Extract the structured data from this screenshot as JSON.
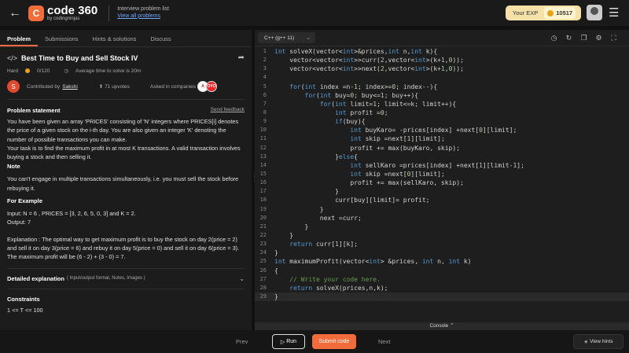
{
  "topbar": {
    "back_icon": "arrow-left-icon",
    "logo_mark": "C",
    "logo_name": "code 360",
    "logo_sub": "by codingninjas",
    "crumb_title": "Interview problem list",
    "crumb_link": "View all problems",
    "exp_label": "Your EXP",
    "exp_value": "10517",
    "menu_icon": "menu-icon"
  },
  "left": {
    "tabs": [
      "Problem",
      "Submissions",
      "Hints & solutions",
      "Discuss"
    ],
    "title": "Best Time to Buy and Sell Stock IV",
    "difficulty": "Hard",
    "score": "0/120",
    "avg_time": "Average time to solve is 20m",
    "contributed_by": "Contributed by",
    "contributor": "Sakshi",
    "contributor_initial": "S",
    "upvotes": "71 upvotes",
    "asked_in": "Asked in companies",
    "companies": [
      "A",
      "OYO"
    ],
    "statement_heading": "Problem statement",
    "send_feedback": "Send feedback",
    "statement_1": "You have been given an array 'PRICES' consisting of 'N' integers where PRICES[i] denotes the price of a given stock on the i-th day. You are also given an integer 'K' denoting the number of possible transactions you can make.",
    "statement_2": "Your task is to find the maximum profit in at most K transactions. A valid transaction involves buying a stock and then selling it.",
    "note_heading": "Note",
    "note_text": "You can't engage in multiple transactions simultaneously, i.e. you must sell the stock before rebuying it.",
    "example_heading": "For Example",
    "example_input": "Input: N = 6 , PRICES = [3, 2, 6, 5, 0, 3] and K = 2.",
    "example_output": "Output: 7",
    "explanation": "Explanation : The optimal way to get maximum profit is to buy the stock on day 2(price = 2) and sell it on day 3(price = 6) and rebuy it on day 5(price = 0) and sell it on day 6(price = 3). The maximum profit will be (6 - 2) + (3 - 0) = 7.",
    "detailed_heading": "Detailed explanation",
    "detailed_sub": "( Input/output format, Notes, Images )",
    "constraints_heading": "Constraints",
    "constraint_1": "1 <= T <= 100"
  },
  "editor": {
    "language": "C++ (g++ 11)",
    "tools": [
      "timer-icon",
      "reset-icon",
      "copy-icon",
      "settings-icon",
      "fullscreen-icon"
    ],
    "lines": [
      "int solveX(vector<int>&prices,int n,int k){",
      "    vector<vector<int>>curr(2,vector<int>(k+1,0));",
      "    vector<vector<int>>next(2,vector<int>(k+1,0));",
      "",
      "    for(int index =n-1; index>=0; index--){",
      "        for(int buy=0; buy<=1; buy++){",
      "            for(int limit=1; limit<=k; limit++){",
      "                int profit =0;",
      "                if(buy){",
      "                    int buyKaro= -prices[index] +next[0][limit];",
      "                    int skip =next[1][limit];",
      "                    profit += max(buyKaro, skip);",
      "                }else{",
      "                    int sellKaro =prices[index] +next[1][limit-1];",
      "                    int skip =next[0][limit];",
      "                    profit += max(sellKaro, skip);",
      "                }",
      "                curr[buy][limit]= profit;",
      "            }",
      "            next =curr;",
      "        }",
      "    }",
      "    return curr[1][k];",
      "}",
      "int maximumProfit(vector<int> &prices, int n, int k)",
      "{",
      "    // Write your code here.",
      "    return solveX(prices,n,k);",
      "}"
    ],
    "current_line": 29
  },
  "console": {
    "label": "Console"
  },
  "bottom": {
    "prev": "Prev",
    "run": "Run",
    "submit": "Submit code",
    "next": "Next",
    "hints": "View hints"
  }
}
